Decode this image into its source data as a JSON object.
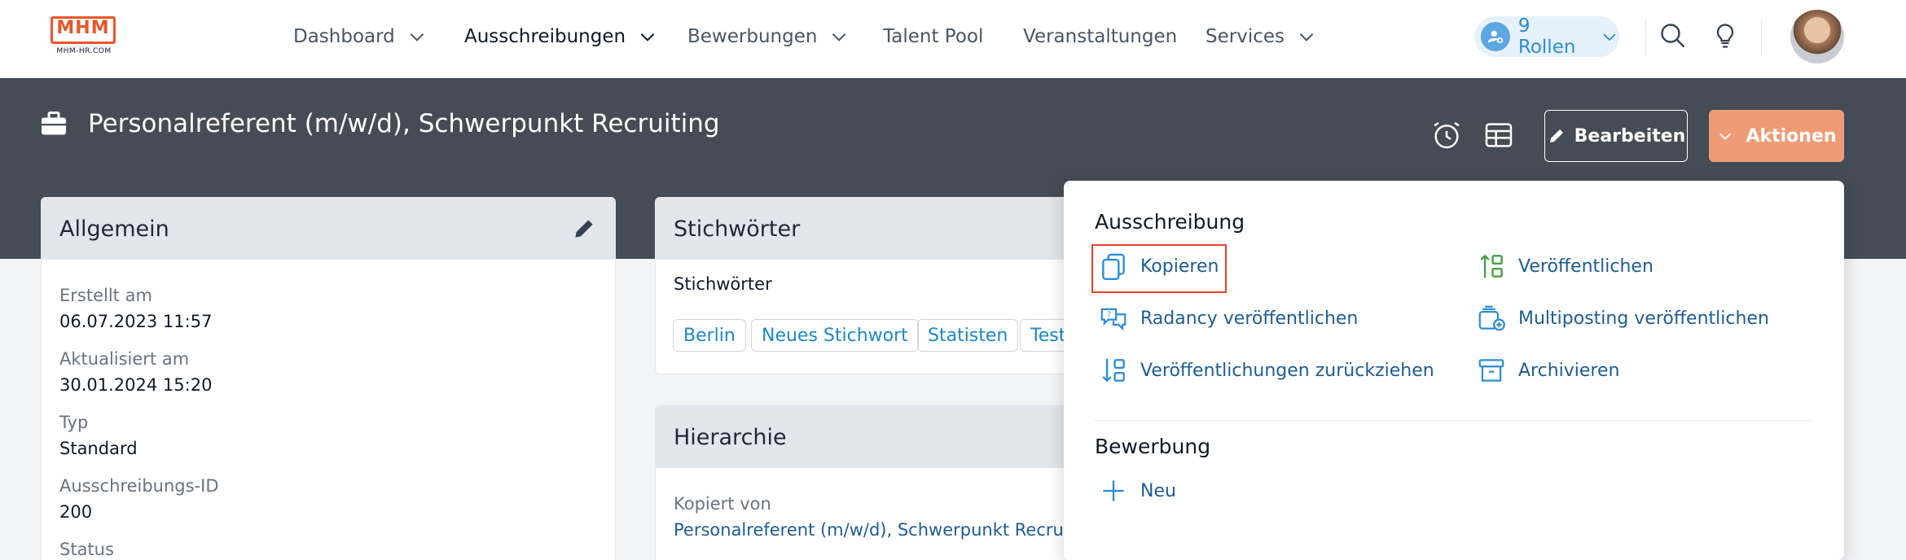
{
  "brand": {
    "logo_mark": "MHM",
    "logo_sub": "MHM-HR.COM",
    "color": "#e8562a"
  },
  "nav": {
    "items": [
      {
        "label": "Dashboard",
        "has_dropdown": true
      },
      {
        "label": "Ausschreibungen",
        "has_dropdown": true,
        "active": true
      },
      {
        "label": "Bewerbungen",
        "has_dropdown": true
      },
      {
        "label": "Talent Pool",
        "has_dropdown": false
      },
      {
        "label": "Veranstaltungen",
        "has_dropdown": false
      },
      {
        "label": "Services",
        "has_dropdown": true
      }
    ],
    "roles_label": "9 Rollen",
    "icons": [
      "search-icon",
      "lightbulb-icon"
    ]
  },
  "header": {
    "title": "Personalreferent (m/w/d), Schwerpunkt Recruiting",
    "edit_label": "Bearbeiten",
    "actions_label": "Aktionen"
  },
  "general_card": {
    "title": "Allgemein",
    "fields": [
      {
        "label": "Erstellt am",
        "value": "06.07.2023 11:57"
      },
      {
        "label": "Aktualisiert am",
        "value": "30.01.2024 15:20"
      },
      {
        "label": "Typ",
        "value": "Standard"
      },
      {
        "label": "Ausschreibungs-ID",
        "value": "200"
      },
      {
        "label": "Status",
        "value": ""
      }
    ]
  },
  "keywords_card": {
    "title": "Stichwörter",
    "sub_label": "Stichwörter",
    "tags": [
      "Berlin",
      "Neues Stichwort",
      "Statisten",
      "Test"
    ]
  },
  "hierarchy_card": {
    "title": "Hierarchie",
    "copied_from_label": "Kopiert von",
    "copied_from_link": "Personalreferent (m/w/d), Schwerpunkt Recruit"
  },
  "actions_menu": {
    "section_ausschreibung": "Ausschreibung",
    "items_left": [
      "Kopieren",
      "Radancy veröffentlichen",
      "Veröffentlichungen zurückziehen"
    ],
    "items_right": [
      "Veröffentlichen",
      "Multiposting veröffentlichen",
      "Archivieren"
    ],
    "section_bewerbung": "Bewerbung",
    "new_label": "Neu",
    "highlighted_item": "Kopieren"
  },
  "colors": {
    "hero_bg": "#464c55",
    "accent_blue": "#1e5d92",
    "link_blue": "#1e88c8",
    "publish_green": "#43a047",
    "actions_orange": "#ef9c76",
    "highlight_red": "#e8402b"
  }
}
